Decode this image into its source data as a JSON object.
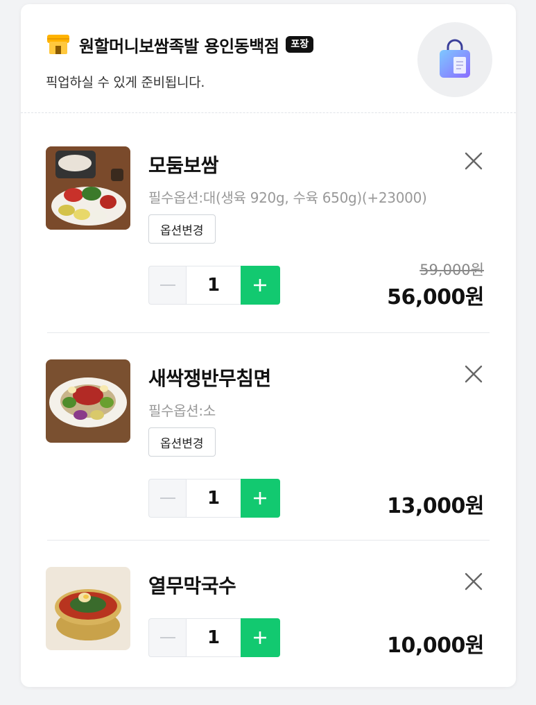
{
  "header": {
    "store_name": "원할머니보쌈족발 용인동백점",
    "badge": "포장",
    "subtitle": "픽업하실 수 있게 준비됩니다.",
    "store_icon": "store-icon",
    "bag_icon": "shopping-bag-icon"
  },
  "items": [
    {
      "name": "모둠보쌈",
      "option": "필수옵션:대(생육 920g, 수육 650g)(+23000)",
      "option_button": "옵션변경",
      "quantity": "1",
      "original_price": "59,000원",
      "price": "56,000원"
    },
    {
      "name": "새싹쟁반무침면",
      "option": "필수옵션:소",
      "option_button": "옵션변경",
      "quantity": "1",
      "price": "13,000원"
    },
    {
      "name": "열무막국수",
      "quantity": "1",
      "price": "10,000원"
    }
  ],
  "colors": {
    "accent_green": "#12c970",
    "badge_bg": "#111111"
  }
}
